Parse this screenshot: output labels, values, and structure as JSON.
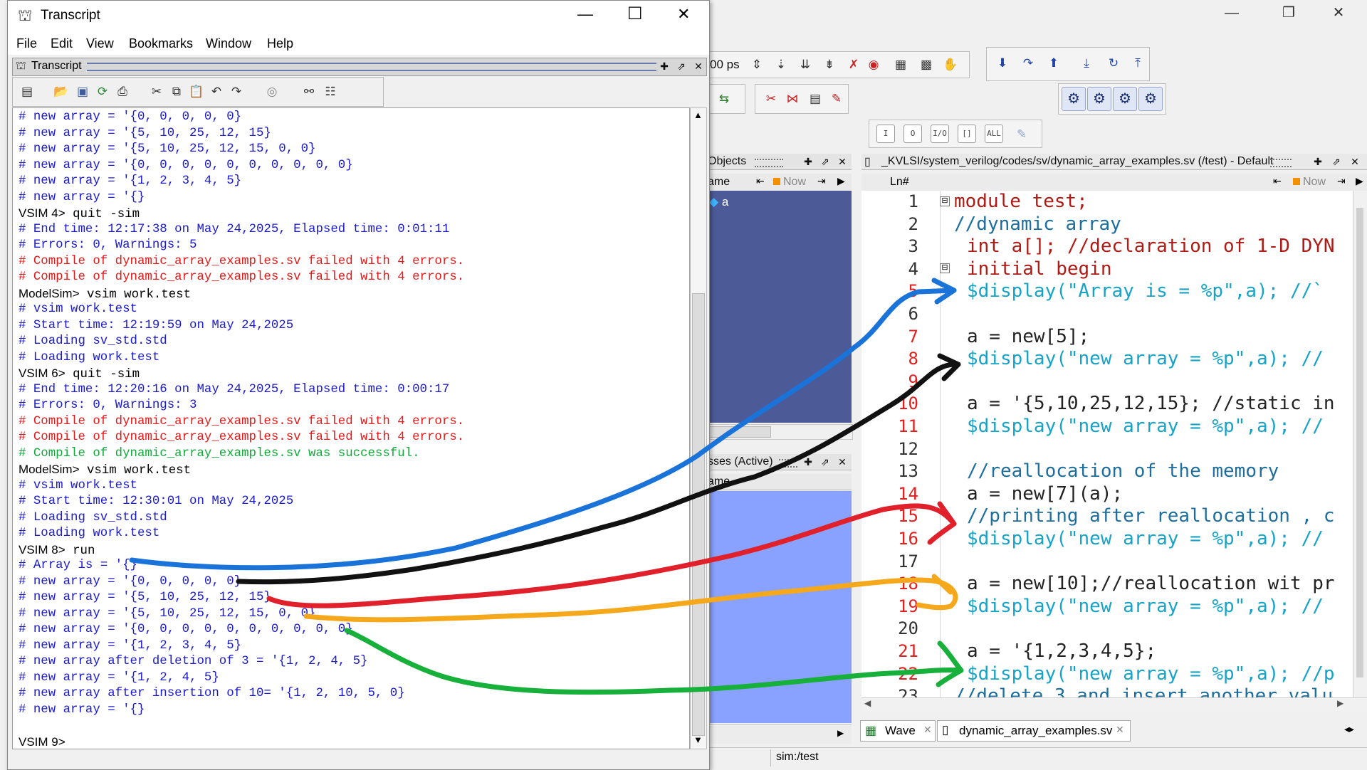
{
  "main_window": {
    "controls": {
      "minimize": "—",
      "restore": "❐",
      "close": "✕"
    },
    "toolbar": {
      "time_value": "00 ps"
    },
    "objects_pane": {
      "title": "Objects",
      "column_name": "ame",
      "column_now": "Now",
      "items": [
        "a"
      ]
    },
    "processes_pane": {
      "title": "sses (Active)",
      "column_name": "ame"
    },
    "source_pane": {
      "title": "_KVLSI/system_verilog/codes/sv/dynamic_array_examples.sv (/test) - Default",
      "ln_header": "Ln#",
      "now_label": "Now",
      "lines": [
        {
          "n": "1",
          "text": "module test;"
        },
        {
          "n": "2",
          "text": "//dynamic array"
        },
        {
          "n": "3",
          "text": "int a[]; //declaration of 1-D DYN"
        },
        {
          "n": "4",
          "text": "initial begin"
        },
        {
          "n": "5",
          "text": "$display(\"Array is = %p\",a); //`"
        },
        {
          "n": "6",
          "text": ""
        },
        {
          "n": "7",
          "text": "a = new[5];"
        },
        {
          "n": "8",
          "text": "$display(\"new array = %p\",a); //"
        },
        {
          "n": "9",
          "text": ""
        },
        {
          "n": "10",
          "text": "a = '{5,10,25,12,15}; //static in"
        },
        {
          "n": "11",
          "text": "$display(\"new array = %p\",a); //"
        },
        {
          "n": "12",
          "text": ""
        },
        {
          "n": "13",
          "text": "//reallocation of the memory"
        },
        {
          "n": "14",
          "text": "a = new[7](a);"
        },
        {
          "n": "15",
          "text": "//printing after reallocation , c"
        },
        {
          "n": "16",
          "text": "$display(\"new array = %p\",a); //"
        },
        {
          "n": "17",
          "text": ""
        },
        {
          "n": "18",
          "text": "a = new[10];//reallocation wit pr"
        },
        {
          "n": "19",
          "text": "$display(\"new array = %p\",a); //"
        },
        {
          "n": "20",
          "text": ""
        },
        {
          "n": "21",
          "text": "a = '{1,2,3,4,5};"
        },
        {
          "n": "22",
          "text": "$display(\"new array = %p\",a); //p"
        },
        {
          "n": "23",
          "text": "//delete 3 and insert another valu"
        }
      ]
    },
    "tabs": [
      {
        "label": "Wave"
      },
      {
        "label": "dynamic_array_examples.sv"
      }
    ],
    "status": "sim:/test"
  },
  "transcript_window": {
    "title": "Transcript",
    "controls": {
      "minimize": "—",
      "maximize": "☐",
      "close": "✕"
    },
    "menu": [
      "File",
      "Edit",
      "View",
      "Bookmarks",
      "Window",
      "Help"
    ],
    "inner_title": "Transcript",
    "lines": [
      {
        "prompt": "",
        "text": "# new array = '{0, 0, 0, 0, 0}",
        "color": "c"
      },
      {
        "prompt": "",
        "text": "# new array = '{5, 10, 25, 12, 15}",
        "color": "c"
      },
      {
        "prompt": "",
        "text": "# new array = '{5, 10, 25, 12, 15, 0, 0}",
        "color": "c"
      },
      {
        "prompt": "",
        "text": "# new array = '{0, 0, 0, 0, 0, 0, 0, 0, 0, 0}",
        "color": "c"
      },
      {
        "prompt": "",
        "text": "# new array = '{1, 2, 3, 4, 5}",
        "color": "c"
      },
      {
        "prompt": "",
        "text": "# new array = '{}",
        "color": "c"
      },
      {
        "prompt": "VSIM 4>",
        "text": " quit -sim",
        "color": "k"
      },
      {
        "prompt": "",
        "text": "# End time: 12:17:38 on May 24,2025, Elapsed time: 0:01:11",
        "color": "c"
      },
      {
        "prompt": "",
        "text": "# Errors: 0, Warnings: 5",
        "color": "c"
      },
      {
        "prompt": "",
        "text": "# Compile of dynamic_array_examples.sv failed with 4 errors.",
        "color": "r"
      },
      {
        "prompt": "",
        "text": "# Compile of dynamic_array_examples.sv failed with 4 errors.",
        "color": "r"
      },
      {
        "prompt": "ModelSim>",
        "text": " vsim work.test",
        "color": "k"
      },
      {
        "prompt": "",
        "text": "# vsim work.test",
        "color": "c"
      },
      {
        "prompt": "",
        "text": "# Start time: 12:19:59 on May 24,2025",
        "color": "c"
      },
      {
        "prompt": "",
        "text": "# Loading sv_std.std",
        "color": "c"
      },
      {
        "prompt": "",
        "text": "# Loading work.test",
        "color": "c"
      },
      {
        "prompt": "VSIM 6>",
        "text": " quit -sim",
        "color": "k"
      },
      {
        "prompt": "",
        "text": "# End time: 12:20:16 on May 24,2025, Elapsed time: 0:00:17",
        "color": "c"
      },
      {
        "prompt": "",
        "text": "# Errors: 0, Warnings: 3",
        "color": "c"
      },
      {
        "prompt": "",
        "text": "# Compile of dynamic_array_examples.sv failed with 4 errors.",
        "color": "r"
      },
      {
        "prompt": "",
        "text": "# Compile of dynamic_array_examples.sv failed with 4 errors.",
        "color": "r"
      },
      {
        "prompt": "",
        "text": "# Compile of dynamic_array_examples.sv was successful.",
        "color": "g"
      },
      {
        "prompt": "ModelSim>",
        "text": " vsim work.test",
        "color": "k"
      },
      {
        "prompt": "",
        "text": "# vsim work.test",
        "color": "c"
      },
      {
        "prompt": "",
        "text": "# Start time: 12:30:01 on May 24,2025",
        "color": "c"
      },
      {
        "prompt": "",
        "text": "# Loading sv_std.std",
        "color": "c"
      },
      {
        "prompt": "",
        "text": "# Loading work.test",
        "color": "c"
      },
      {
        "prompt": "VSIM 8>",
        "text": " run",
        "color": "k"
      },
      {
        "prompt": "",
        "text": "# Array is = '{}",
        "color": "c"
      },
      {
        "prompt": "",
        "text": "# new array = '{0, 0, 0, 0, 0}",
        "color": "c"
      },
      {
        "prompt": "",
        "text": "# new array = '{5, 10, 25, 12, 15}",
        "color": "c"
      },
      {
        "prompt": "",
        "text": "# new array = '{5, 10, 25, 12, 15, 0, 0}",
        "color": "c"
      },
      {
        "prompt": "",
        "text": "# new array = '{0, 0, 0, 0, 0, 0, 0, 0, 0, 0}",
        "color": "c"
      },
      {
        "prompt": "",
        "text": "# new array = '{1, 2, 3, 4, 5}",
        "color": "c"
      },
      {
        "prompt": "",
        "text": "# new array after deletion of 3 = '{1, 2, 4, 5}",
        "color": "c"
      },
      {
        "prompt": "",
        "text": "# new array = '{1, 2, 4, 5}",
        "color": "c"
      },
      {
        "prompt": "",
        "text": "# new array after insertion of 10= '{1, 2, 10, 5, 0}",
        "color": "c"
      },
      {
        "prompt": "",
        "text": "# new array = '{}",
        "color": "c"
      },
      {
        "prompt": "",
        "text": "",
        "color": "k"
      },
      {
        "prompt": "VSIM 9>",
        "text": "",
        "color": "k"
      }
    ]
  },
  "annotations": {
    "arrow_colors": [
      "#1a73d9",
      "#111111",
      "#e0202a",
      "#f5a81c",
      "#16b03a"
    ]
  }
}
